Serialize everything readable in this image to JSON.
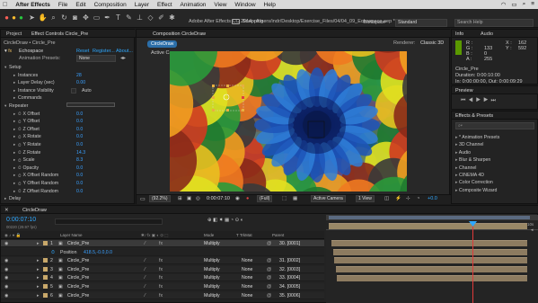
{
  "menubar": {
    "apple": "",
    "app": "After Effects",
    "items": [
      "File",
      "Edit",
      "Composition",
      "Layer",
      "Effect",
      "Animation",
      "View",
      "Window",
      "Help"
    ],
    "right_icons": [
      "wifi-icon",
      "battery-icon",
      "search-icon",
      "list-icon"
    ]
  },
  "app_title": "Adobe After Effects CC 2014 - /Users/indr/Desktop/Exercise_Files/04/04_09_Echospace.aep *",
  "toolbar": {
    "snapping": "Snapping",
    "workspace_label": "Workspace",
    "workspace_value": "Standard",
    "search_placeholder": "Search Help"
  },
  "left_panel": {
    "project_tab": "Project",
    "effect_controls_tab": "Effect Controls Circle_Pre",
    "breadcrumb": "CircleDraw • Circle_Pre",
    "effect_name": "Echospace",
    "reset": "Reset",
    "register": "Register...",
    "about": "About...",
    "animation_presets_label": "Animation Presets:",
    "animation_presets_value": "None",
    "rows": [
      {
        "label": "Setup",
        "indent": 0,
        "value": ""
      },
      {
        "label": "Instances",
        "indent": 2,
        "value": "28"
      },
      {
        "label": "Layer Delay (sec)",
        "indent": 2,
        "value": "0.00"
      },
      {
        "label": "Instance Visibility",
        "indent": 2,
        "value": "Auto"
      },
      {
        "label": "Commands",
        "indent": 2,
        "value": ""
      },
      {
        "label": "Repeater",
        "indent": 0,
        "value": ""
      },
      {
        "label": "X Offset",
        "indent": 2,
        "value": "0.0"
      },
      {
        "label": "Y Offset",
        "indent": 2,
        "value": "0.0"
      },
      {
        "label": "Z Offset",
        "indent": 2,
        "value": "0.0"
      },
      {
        "label": "X Rotate",
        "indent": 2,
        "value": "0.0"
      },
      {
        "label": "Y Rotate",
        "indent": 2,
        "value": "0.0"
      },
      {
        "label": "Z Rotate",
        "indent": 2,
        "value": "14.3"
      },
      {
        "label": "Scale",
        "indent": 2,
        "value": "8.3"
      },
      {
        "label": "Opacity",
        "indent": 2,
        "value": "0.0"
      },
      {
        "label": "X Offset Random",
        "indent": 2,
        "value": "0.0"
      },
      {
        "label": "Y Offset Random",
        "indent": 2,
        "value": "0.0"
      },
      {
        "label": "Z Offset Random",
        "indent": 2,
        "value": "0.0"
      },
      {
        "label": "Delay",
        "indent": 0,
        "value": ""
      }
    ]
  },
  "comp_panel": {
    "tab": "Composition CircleDraw",
    "crumb": "CircleDraw",
    "renderer_label": "Renderer:",
    "renderer_value": "Classic 3D",
    "camera_label": "Active Camera",
    "zoom": "(92.2%)",
    "time": "0:00:07:10",
    "resolution": "(Full)",
    "camera_view": "Active Camera",
    "views": "1 View",
    "exposure": "+0.0"
  },
  "info_panel": {
    "info_tab": "Info",
    "audio_tab": "Audio",
    "r_label": "R :",
    "g_label": "G :",
    "b_label": "B :",
    "a_label": "A :",
    "g_value": "133",
    "b_value": "0",
    "a_value": "255",
    "x_label": "X :",
    "x_value": "162",
    "y_label": "Y :",
    "y_value": "592",
    "layer_name": "Circle_Pre",
    "duration": "Duration: 0:00:10:00",
    "in_out": "In: 0:00:00:00, Out: 0:00:09:29"
  },
  "preview_panel": {
    "tab": "Preview"
  },
  "effects_presets": {
    "tab": "Effects & Presets",
    "search_placeholder": "⌕▾",
    "items": [
      "* Animation Presets",
      "3D Channel",
      "Audio",
      "Blur & Sharpen",
      "Channel",
      "CINEMA 4D",
      "Color Correction",
      "Composite Wizard"
    ]
  },
  "timeline": {
    "tab": "CircleDraw",
    "timecode": "0:00:07:10",
    "frames": "00220 (29.97 fps)",
    "headers": {
      "layer_name": "Layer Name",
      "mode": "Mode",
      "trkmat": "T  TrkMat",
      "parent": "Parent"
    },
    "ruler": [
      "00s",
      "02s",
      "04s",
      "06s",
      "08s",
      "10s"
    ],
    "rows": [
      {
        "num": "1",
        "name": "Circle_Pre",
        "mode": "Multiply",
        "trkmat": "",
        "parent": "30. [0001]"
      },
      {
        "num": "",
        "name": "Position",
        "mode": "",
        "trkmat": "",
        "parent": "",
        "value": "418.5,-0.0,0.0"
      },
      {
        "num": "2",
        "name": "Circle_Pre",
        "mode": "Multiply",
        "trkmat": "None",
        "parent": "31. [0002]"
      },
      {
        "num": "3",
        "name": "Circle_Pre",
        "mode": "Multiply",
        "trkmat": "None",
        "parent": "32. [0003]"
      },
      {
        "num": "4",
        "name": "Circle_Pre",
        "mode": "Multiply",
        "trkmat": "None",
        "parent": "33. [0004]"
      },
      {
        "num": "5",
        "name": "Circle_Pre",
        "mode": "Multiply",
        "trkmat": "None",
        "parent": "34. [0005]"
      },
      {
        "num": "6",
        "name": "Circle_Pre",
        "mode": "Multiply",
        "trkmat": "None",
        "parent": "35. [0006]"
      }
    ]
  },
  "colors": {
    "accent": "#2ea8ff",
    "playhead": "#e03a3a",
    "bar": "#8d7b60"
  }
}
